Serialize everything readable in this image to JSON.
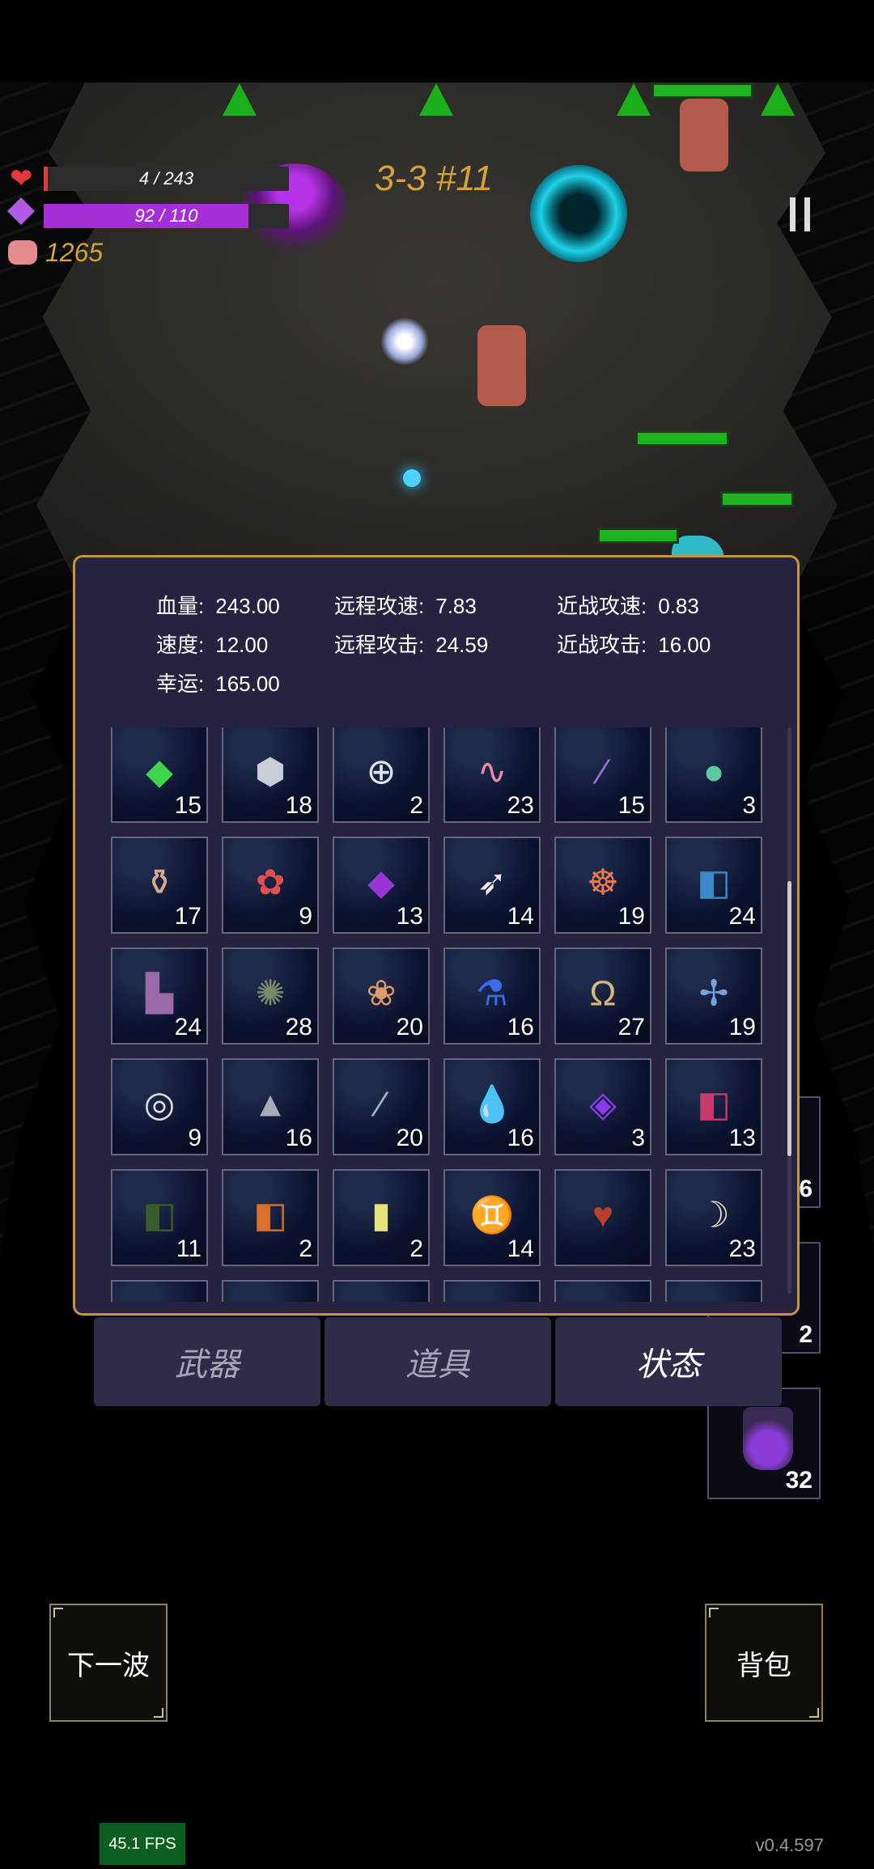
{
  "hud": {
    "health": "4 / 243",
    "health_fill": 0.016,
    "mana": "92 / 110",
    "mana_fill": 0.836,
    "coins": "1265",
    "stage": "3-3 #11",
    "icons": [
      "heart-icon",
      "mana-gem-icon",
      "pig-icon",
      "pause-icon"
    ]
  },
  "stats": [
    {
      "label": "血量:",
      "value": "243.00"
    },
    {
      "label": "远程攻速:",
      "value": "7.83"
    },
    {
      "label": "近战攻速:",
      "value": "0.83"
    },
    {
      "label": "速度:",
      "value": "12.00"
    },
    {
      "label": "远程攻击:",
      "value": "24.59"
    },
    {
      "label": "近战攻击:",
      "value": "16.00"
    },
    {
      "label": "幸运:",
      "value": "165.00"
    }
  ],
  "items": [
    {
      "icon": "green-crystal-icon",
      "count": "15"
    },
    {
      "icon": "silver-ore-icon",
      "count": "18"
    },
    {
      "icon": "ring-cross-icon",
      "count": "2"
    },
    {
      "icon": "worm-icon",
      "count": "23"
    },
    {
      "icon": "vial-icon",
      "count": "15"
    },
    {
      "icon": "rainbow-orb-icon",
      "count": "3"
    },
    {
      "icon": "vase-icon",
      "count": "17"
    },
    {
      "icon": "red-flower-icon",
      "count": "9"
    },
    {
      "icon": "purple-snail-icon",
      "count": "13"
    },
    {
      "icon": "feather-icon",
      "count": "14"
    },
    {
      "icon": "skull-feather-icon",
      "count": "19"
    },
    {
      "icon": "blue-book-icon",
      "count": "24"
    },
    {
      "icon": "boots-icon",
      "count": "24"
    },
    {
      "icon": "octopus-icon",
      "count": "28"
    },
    {
      "icon": "flowers-icon",
      "count": "20"
    },
    {
      "icon": "blue-potion-icon",
      "count": "16"
    },
    {
      "icon": "horseshoe-icon",
      "count": "27"
    },
    {
      "icon": "dragonfly-icon",
      "count": "19"
    },
    {
      "icon": "rings-icon",
      "count": "9"
    },
    {
      "icon": "cloak-icon",
      "count": "16"
    },
    {
      "icon": "bottle-icon",
      "count": "20"
    },
    {
      "icon": "water-drop-icon",
      "count": "16"
    },
    {
      "icon": "purple-chip-icon",
      "count": "3"
    },
    {
      "icon": "red-book-icon",
      "count": "13"
    },
    {
      "icon": "green-book-icon",
      "count": "11"
    },
    {
      "icon": "orange-book-icon",
      "count": "2"
    },
    {
      "icon": "yellow-card-icon",
      "count": "2"
    },
    {
      "icon": "twin-figures-icon",
      "count": "14"
    },
    {
      "icon": "heart-organ-icon",
      "count": ""
    },
    {
      "icon": "horn-icon",
      "count": "23"
    }
  ],
  "tabs": [
    {
      "label": "武器",
      "active": false
    },
    {
      "label": "道具",
      "active": false
    },
    {
      "label": "状态",
      "active": true
    }
  ],
  "side_slots": [
    "6",
    "2",
    "32"
  ],
  "buttons": {
    "next_wave": "下一波",
    "backpack": "背包"
  },
  "fps": "45.1 FPS",
  "version": "v0.4.597",
  "colors": {
    "panel_bg": "#262340",
    "panel_border": "#c8943e",
    "mana": "#a52fd6",
    "health": "#e23a3a",
    "coins": "#d2a33a"
  }
}
